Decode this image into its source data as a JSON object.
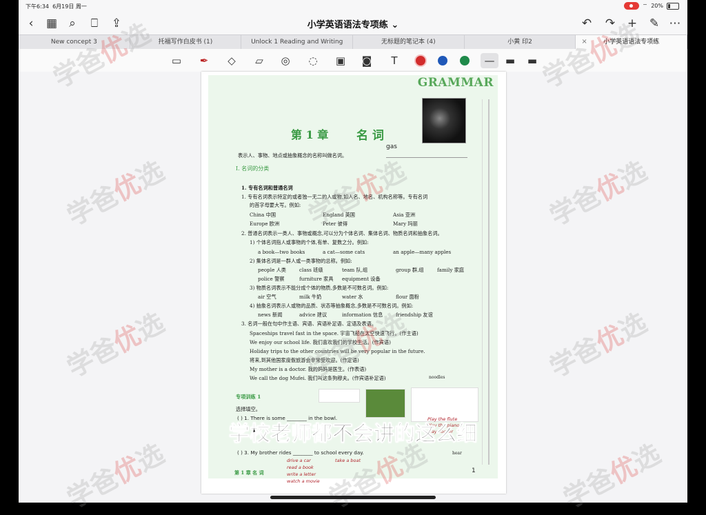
{
  "status": {
    "time": "下午6:34",
    "date": "6月19日 周一",
    "battery": "20%",
    "battery_level": 0.2
  },
  "nav": {
    "title": "小学英语语法专项练"
  },
  "tabs": [
    {
      "label": "New concept 3"
    },
    {
      "label": "托福写作白皮书 (1)"
    },
    {
      "label": "Unlock 1 Reading and Writing"
    },
    {
      "label": "无标题的笔记本 (4)"
    },
    {
      "label": "小黄 印2"
    },
    {
      "label": "小学英语语法专项练",
      "active": true
    }
  ],
  "toolbar": {
    "colors": [
      "#d22c2c",
      "#1f58b8",
      "#1f8a4a"
    ]
  },
  "page": {
    "grammar": "GRAMMAR",
    "chapter": "第 1 章",
    "chapter_word": "名  词",
    "gas_word": "gas",
    "intro": "表示人、事物、地点或抽象概念的名称叫做名词。",
    "section1": "Ⅰ. 名词的分类",
    "sub1": "1. 专有名词和普通名词",
    "l1": "1. 专有名词表示特定的或者独一无二的人或物,如人名、地名、机构名称等。专有名词",
    "l2": "的首字母要大写。例如:",
    "ex1": [
      "China 中国",
      "England 英国",
      "Asia 亚洲"
    ],
    "ex2": [
      "Europe 欧洲",
      "Peter 彼得",
      "Mary 玛丽"
    ],
    "l3": "2. 普通名词表示一类人、事物或概念,可以分为个体名词、集体名词、物质名词和抽象名词。",
    "l4": "1) 个体名词指人或事物的个体,有单、复数之分。例如:",
    "ex3": [
      "a book—two books",
      "a cat—some cats",
      "an apple—many apples"
    ],
    "l5": "2) 集体名词是一群人或一类事物的总称。例如:",
    "ex4": [
      "people 人类",
      "class 班级",
      "team 队,组",
      "group 群,组",
      "family 家庭"
    ],
    "ex5": [
      "police 警察",
      "furniture 家具",
      "equipment 设备"
    ],
    "l6": "3) 物质名词表示不能分成个体的物质,多数是不可数名词。例如:",
    "ex6": [
      "air 空气",
      "milk 牛奶",
      "water 水",
      "flour 面粉"
    ],
    "l7": "4) 抽象名词表示人或物的品质、状态等抽象概念,多数是不可数名词。例如:",
    "ex7": [
      "news 新闻",
      "advice 建议",
      "information 信息",
      "friendship 友谊"
    ],
    "l8": "3. 名词一般在句中作主语、宾语、宾语补足语、定语及表语。",
    "s1": "Spaceships travel fast in the space. 宇宙飞船在太空快速飞行。(作主语)",
    "s2": "We enjoy our school life. 我们喜欢我们的学校生活。(作宾语)",
    "s3": "Holiday trips to the other countries will be very popular in the future.",
    "s3b": "将来,到其他国家度假旅游会非常受欢迎。(作定语)",
    "s4": "My mother is a doctor. 我的妈妈是医生。(作表语)",
    "s5": "We call the dog Mufei. 我们叫这条狗穆夫。(作宾语补足语)",
    "s5_note": "noodles",
    "practice": "专项训练 1",
    "fill": "选择填空。",
    "q1": "(    ) 1. There is some ________ in the bowl.",
    "q3": "(    ) 3. My brother rides ________ to school every day.",
    "hand1": [
      "drive a car",
      "read a book",
      "write a letter",
      "watch a movie"
    ],
    "hand2": [
      "take a boat"
    ],
    "hand3": [
      "Play the flute",
      "Play the piano",
      "play soccer"
    ],
    "thumb_note": "hear",
    "footer": "第 1 章   名  词",
    "pagenum": "1"
  },
  "subtitle": "学校老师都不会讲的这么细",
  "watermark": {
    "prefix": "学爸",
    "accent": "优",
    "suffix": "选"
  }
}
